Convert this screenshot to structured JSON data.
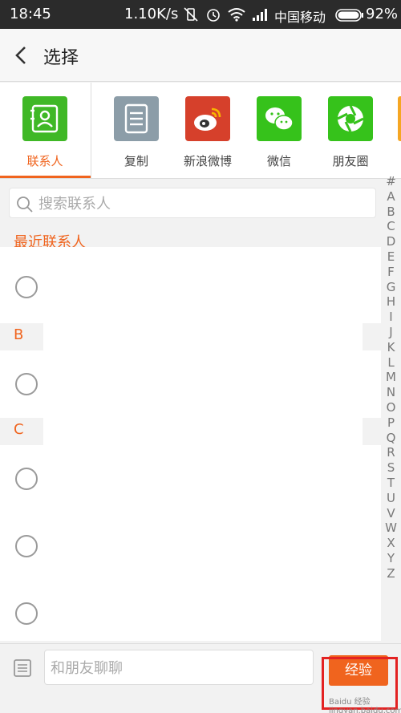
{
  "status_bar": {
    "time": "18:45",
    "net_speed": "1.10K/s",
    "carrier": "中国移动",
    "battery": "92%"
  },
  "header": {
    "title": "选择"
  },
  "share": [
    {
      "label": "联系人",
      "color": "#3fb826",
      "icon": "contacts-icon",
      "active": true
    },
    {
      "label": "复制",
      "color": "#8c9da8",
      "icon": "copy-icon",
      "active": false
    },
    {
      "label": "新浪微博",
      "color": "#d6402b",
      "icon": "weibo-icon",
      "active": false
    },
    {
      "label": "微信",
      "color": "#36c21b",
      "icon": "wechat-icon",
      "active": false
    },
    {
      "label": "朋友圈",
      "color": "#36c21b",
      "icon": "moments-icon",
      "active": false
    }
  ],
  "search": {
    "placeholder": "搜索联系人"
  },
  "sections": {
    "recent": "最近联系人",
    "b": "B",
    "c": "C"
  },
  "alphabet": [
    "#",
    "A",
    "B",
    "C",
    "D",
    "E",
    "F",
    "G",
    "H",
    "I",
    "J",
    "K",
    "L",
    "M",
    "N",
    "O",
    "P",
    "Q",
    "R",
    "S",
    "T",
    "U",
    "V",
    "W",
    "X",
    "Y",
    "Z"
  ],
  "bottom": {
    "placeholder": "和朋友聊聊",
    "send_label": "经验"
  },
  "watermark": "Baidu 经验  jingyan.baidu.com",
  "colors": {
    "accent": "#f0641e",
    "highlight": "#e32222"
  }
}
